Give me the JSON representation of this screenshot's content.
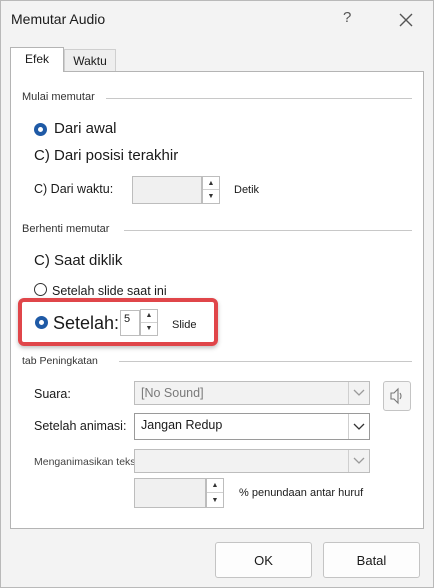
{
  "window": {
    "title": "Memutar Audio",
    "help_glyph": "?",
    "close_icon": "close-icon"
  },
  "tabs": [
    {
      "label": "Efek",
      "selected": true
    },
    {
      "label": "Waktu",
      "selected": false
    }
  ],
  "start": {
    "group_title": "Mulai memutar",
    "from_beginning": {
      "label": "Dari awal",
      "selected": true
    },
    "from_last": {
      "label": "C) Dari posisi terakhir",
      "selected": false
    },
    "from_time": {
      "label": "C) Dari waktu:",
      "value": "",
      "unit": "Detik",
      "selected": false
    }
  },
  "stop": {
    "group_title": "Berhenti memutar",
    "on_click": {
      "label": "C) Saat diklik",
      "selected": false
    },
    "after_current": {
      "label": "Setelah slide saat ini",
      "selected": false
    },
    "after": {
      "label": "Setelah:",
      "value": "5",
      "unit": "Slide",
      "selected": true
    }
  },
  "enhancements": {
    "group_title": "tab Peningkatan",
    "sound": {
      "label": "Suara:",
      "value": "[No Sound]",
      "enabled": false
    },
    "after_animation": {
      "label": "Setelah animasi:",
      "value": "Jangan Redup",
      "enabled": true
    },
    "animate_text": {
      "label": "Menganimasikan teks:",
      "value": "",
      "enabled": false
    },
    "delay": {
      "value": "",
      "label": "% penundaan antar huruf"
    }
  },
  "buttons": {
    "ok": "OK",
    "cancel": "Batal"
  },
  "highlight_color": "#e0464a",
  "accent_color": "#1f5aa6"
}
